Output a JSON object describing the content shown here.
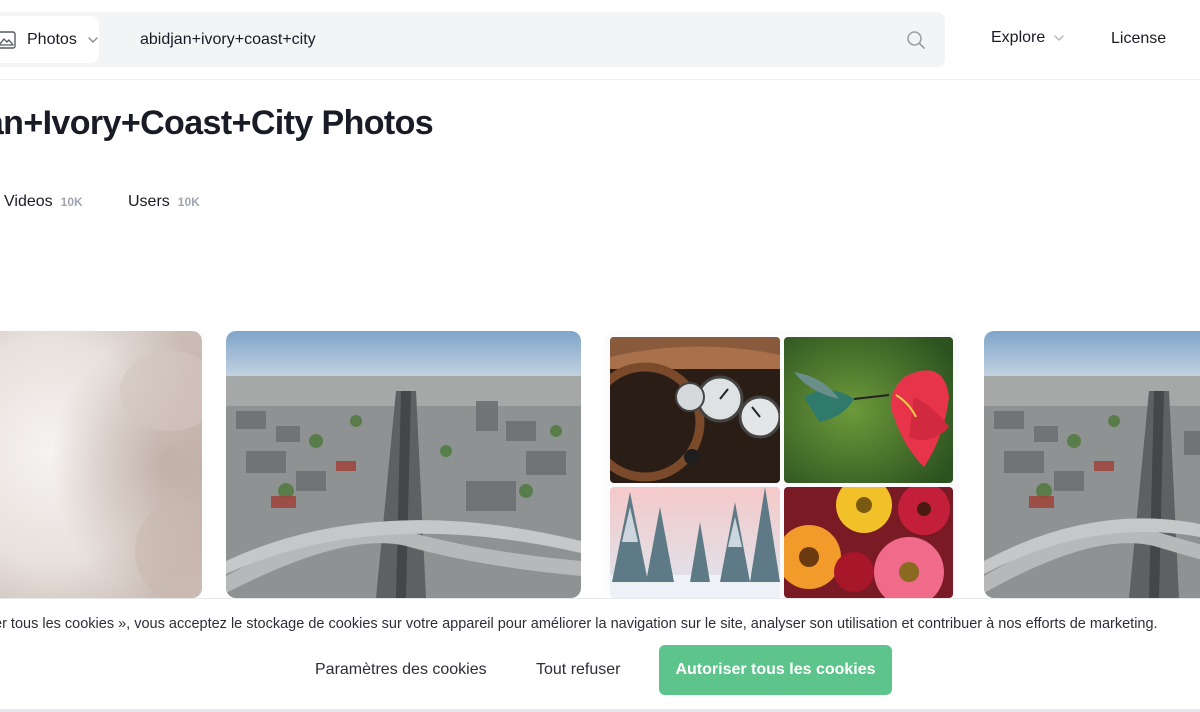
{
  "header": {
    "type_select_label": "Photos",
    "search_value": "abidjan+ivory+coast+city",
    "nav_explore": "Explore",
    "nav_license": "License"
  },
  "page": {
    "title": "jan+Ivory+Coast+City Photos"
  },
  "tabs": [
    {
      "label": "Videos",
      "count": "10K"
    },
    {
      "label": "Users",
      "count": "10K"
    }
  ],
  "cookie_banner": {
    "text": "er tous les cookies », vous acceptez le stockage de cookies sur votre appareil pour améliorer la navigation sur le site, analyser son utilisation et contribuer à nos efforts de marketing.",
    "settings_label": "Paramètres des cookies",
    "refuse_label": "Tout refuser",
    "accept_label": "Autoriser tous les cookies"
  },
  "colors": {
    "accent_green": "#5dc48b",
    "search_bg": "#f3f4f6",
    "text": "#191b26",
    "muted": "#a0a5b1"
  },
  "icons": [
    "image-icon",
    "chevron-down-icon",
    "search-icon"
  ]
}
